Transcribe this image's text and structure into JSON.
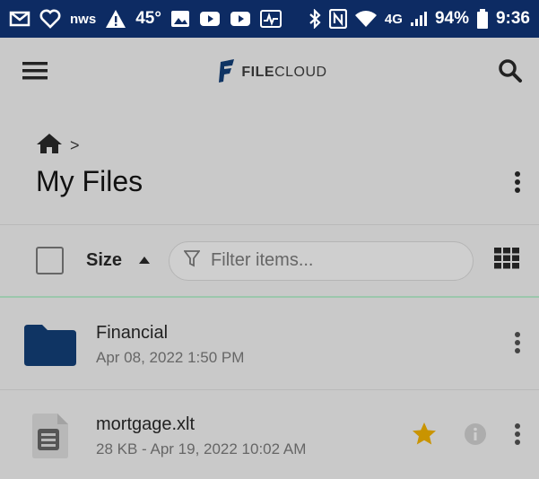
{
  "status_bar": {
    "temperature": "45°",
    "network": "4G",
    "battery": "94%",
    "time": "9:36",
    "icons": [
      "gmail-icon",
      "heart-icon",
      "nws-icon",
      "warning-icon",
      "image-icon",
      "youtube-icon",
      "youtube-icon",
      "activity-icon",
      "bluetooth-icon",
      "nfc-icon",
      "wifi-icon",
      "signal-icon",
      "battery-icon"
    ]
  },
  "app_bar": {
    "brand_bold": "FILE",
    "brand_light": "CLOUD",
    "menu_icon": "menu-icon",
    "search_icon": "search-icon"
  },
  "breadcrumb": {
    "home_icon": "home-icon",
    "separator": ">"
  },
  "page": {
    "title": "My Files"
  },
  "toolbar": {
    "sort_label": "Size",
    "filter_placeholder": "Filter items...",
    "view_icon": "grid-view-icon"
  },
  "files": [
    {
      "name": "Financial",
      "meta": "Apr 08, 2022 1:50 PM",
      "type": "folder",
      "starred": false
    },
    {
      "name": "mortgage.xlt",
      "meta": "28 KB - Apr 19, 2022 10:02 AM",
      "type": "document",
      "starred": true
    }
  ],
  "colors": {
    "status_bar": "#0d2b63",
    "folder": "#0f3463",
    "star": "#c99400",
    "scrim_bg": "#c9c9c9",
    "accent_line": "#9cc7ac"
  }
}
